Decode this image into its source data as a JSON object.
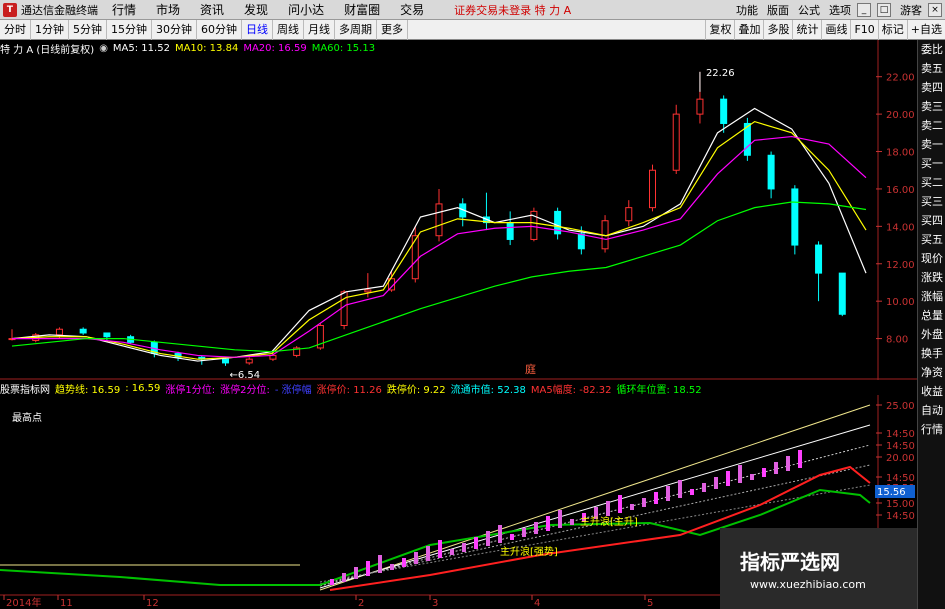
{
  "app": {
    "name": "通达信金融终端",
    "menus": [
      "行情",
      "市场",
      "资讯",
      "发现",
      "问小达",
      "财富圈",
      "交易"
    ],
    "warning": "证券交易未登录  特 力 A",
    "right_menus": [
      "功能",
      "版面",
      "公式",
      "选项"
    ],
    "guest": "游客"
  },
  "periods": [
    "分时",
    "1分钟",
    "5分钟",
    "15分钟",
    "30分钟",
    "60分钟",
    "日线",
    "周线",
    "月线",
    "多周期",
    "更多"
  ],
  "active_period": "日线",
  "toolbar_right": [
    "复权",
    "叠加",
    "多股",
    "统计",
    "画线",
    "F10",
    "标记",
    "+自选"
  ],
  "main_info": {
    "stock": "特 力 A (日线前复权)",
    "ma5": "MA5: 11.52",
    "ma10": "MA10: 13.84",
    "ma20": "MA20: 16.59",
    "ma60": "MA60: 15.13"
  },
  "price_axis": [
    "22.00",
    "20.00",
    "18.00",
    "16.00",
    "14.00",
    "12.00",
    "10.00",
    "8.00"
  ],
  "annotations": {
    "high": "22.26",
    "low": "6.54",
    "marker": "庭"
  },
  "sub_info": {
    "name": "股票指标网",
    "items": [
      "趋势线: 16.59",
      ": 16.59",
      "涨停1分位: ",
      "涨停2分位: ",
      "- 涨停幅",
      "涨停价: 11.26",
      "跌停价: 9.22",
      "流通市值: 52.38",
      "MA5幅度: -82.32",
      "循环年位置: 18.52"
    ]
  },
  "sub_text": {
    "left": "最高点",
    "wave_a": "主升浪[主升]",
    "wave_b": "主升浪[强势]"
  },
  "sub_axis": [
    "25.00",
    "14:50",
    "14:50",
    "20.00",
    "14:50",
    "17.50",
    "15.00",
    "14:50"
  ],
  "sub_current": "15.56",
  "date_axis": [
    "2014年",
    "11",
    "12",
    "2",
    "3",
    "4",
    "5"
  ],
  "side_panel": [
    "委比",
    "卖五",
    "卖四",
    "卖三",
    "卖二",
    "卖一",
    "买一",
    "买二",
    "买三",
    "买四",
    "买五",
    "现价",
    "涨跌",
    "涨幅",
    "总量",
    "外盘",
    "换手",
    "净资",
    "收益",
    "自动",
    "行情"
  ],
  "watermark": {
    "title": "指标严选网",
    "url": "www.xuezhibiao.com"
  },
  "colors": {
    "ma5": "#ffffff",
    "ma10": "#ffff00",
    "ma20": "#ff00ff",
    "ma60": "#00ff00",
    "up": "#ff3232",
    "down": "#00ffff"
  },
  "chart_data": {
    "type": "line",
    "title": "特 力 A (日线前复权)",
    "ylim": [
      6,
      23
    ],
    "series": [
      {
        "name": "MA5",
        "values": [
          8.0,
          8.2,
          8.1,
          7.6,
          7.1,
          6.8,
          7.0,
          7.3,
          9.5,
          10.5,
          10.8,
          14.5,
          15.0,
          14.2,
          14.6,
          13.8,
          13.5,
          14.0,
          15.2,
          19.0,
          20.3,
          19.2,
          16.3,
          11.5
        ]
      },
      {
        "name": "MA10",
        "values": [
          8.0,
          8.1,
          8.1,
          7.7,
          7.2,
          6.9,
          7.0,
          7.2,
          9.0,
          10.2,
          10.6,
          13.7,
          14.4,
          14.2,
          14.2,
          13.9,
          13.5,
          14.2,
          15.0,
          18.2,
          19.6,
          19.0,
          17.0,
          13.8
        ]
      },
      {
        "name": "MA20",
        "values": [
          8.0,
          8.0,
          8.0,
          7.8,
          7.4,
          7.1,
          7.0,
          7.1,
          8.4,
          9.8,
          10.3,
          12.4,
          13.6,
          13.9,
          14.0,
          13.7,
          13.3,
          13.8,
          14.4,
          16.8,
          18.6,
          18.8,
          18.4,
          16.6
        ]
      },
      {
        "name": "MA60",
        "values": [
          7.6,
          7.8,
          8.0,
          8.0,
          7.8,
          7.6,
          7.4,
          7.3,
          7.5,
          8.2,
          8.9,
          9.6,
          10.2,
          10.8,
          11.3,
          11.6,
          11.8,
          12.4,
          13.0,
          14.3,
          15.0,
          15.3,
          15.2,
          14.9
        ]
      }
    ],
    "candles": [
      [
        8.0,
        8.0,
        8.5,
        7.9
      ],
      [
        7.9,
        8.2,
        8.3,
        7.8
      ],
      [
        8.2,
        8.5,
        8.6,
        8.0
      ],
      [
        8.5,
        8.3,
        8.6,
        8.2
      ],
      [
        8.3,
        8.1,
        8.3,
        7.9
      ],
      [
        8.1,
        7.8,
        8.2,
        7.7
      ],
      [
        7.8,
        7.2,
        7.9,
        7.0
      ],
      [
        7.2,
        7.0,
        7.3,
        6.8
      ],
      [
        7.0,
        6.9,
        7.1,
        6.6
      ],
      [
        6.9,
        6.7,
        7.0,
        6.54
      ],
      [
        6.7,
        6.9,
        7.0,
        6.6
      ],
      [
        6.9,
        7.1,
        7.2,
        6.8
      ],
      [
        7.1,
        7.5,
        7.6,
        7.0
      ],
      [
        7.5,
        8.7,
        8.8,
        7.4
      ],
      [
        8.7,
        10.5,
        10.6,
        8.5
      ],
      [
        10.5,
        10.6,
        11.5,
        10.2
      ],
      [
        10.6,
        11.2,
        11.6,
        10.5
      ],
      [
        11.2,
        13.5,
        14.0,
        11.0
      ],
      [
        13.5,
        15.2,
        16.0,
        13.2
      ],
      [
        15.2,
        14.5,
        15.5,
        14.0
      ],
      [
        14.5,
        14.2,
        15.8,
        13.8
      ],
      [
        14.2,
        13.3,
        14.8,
        13.0
      ],
      [
        13.3,
        14.8,
        15.0,
        13.2
      ],
      [
        14.8,
        13.6,
        15.0,
        13.3
      ],
      [
        13.6,
        12.8,
        14.0,
        12.5
      ],
      [
        12.8,
        14.3,
        14.6,
        12.6
      ],
      [
        14.3,
        15.0,
        15.4,
        14.0
      ],
      [
        15.0,
        17.0,
        17.3,
        14.8
      ],
      [
        17.0,
        20.0,
        20.5,
        16.8
      ],
      [
        20.0,
        20.8,
        22.26,
        19.5
      ],
      [
        20.8,
        19.5,
        21.0,
        19.0
      ],
      [
        19.5,
        17.8,
        19.8,
        17.5
      ],
      [
        17.8,
        16.0,
        18.0,
        15.5
      ],
      [
        16.0,
        13.0,
        16.2,
        12.5
      ],
      [
        13.0,
        11.5,
        13.2,
        10.0
      ],
      [
        11.5,
        9.3,
        11.5,
        9.2
      ]
    ]
  }
}
